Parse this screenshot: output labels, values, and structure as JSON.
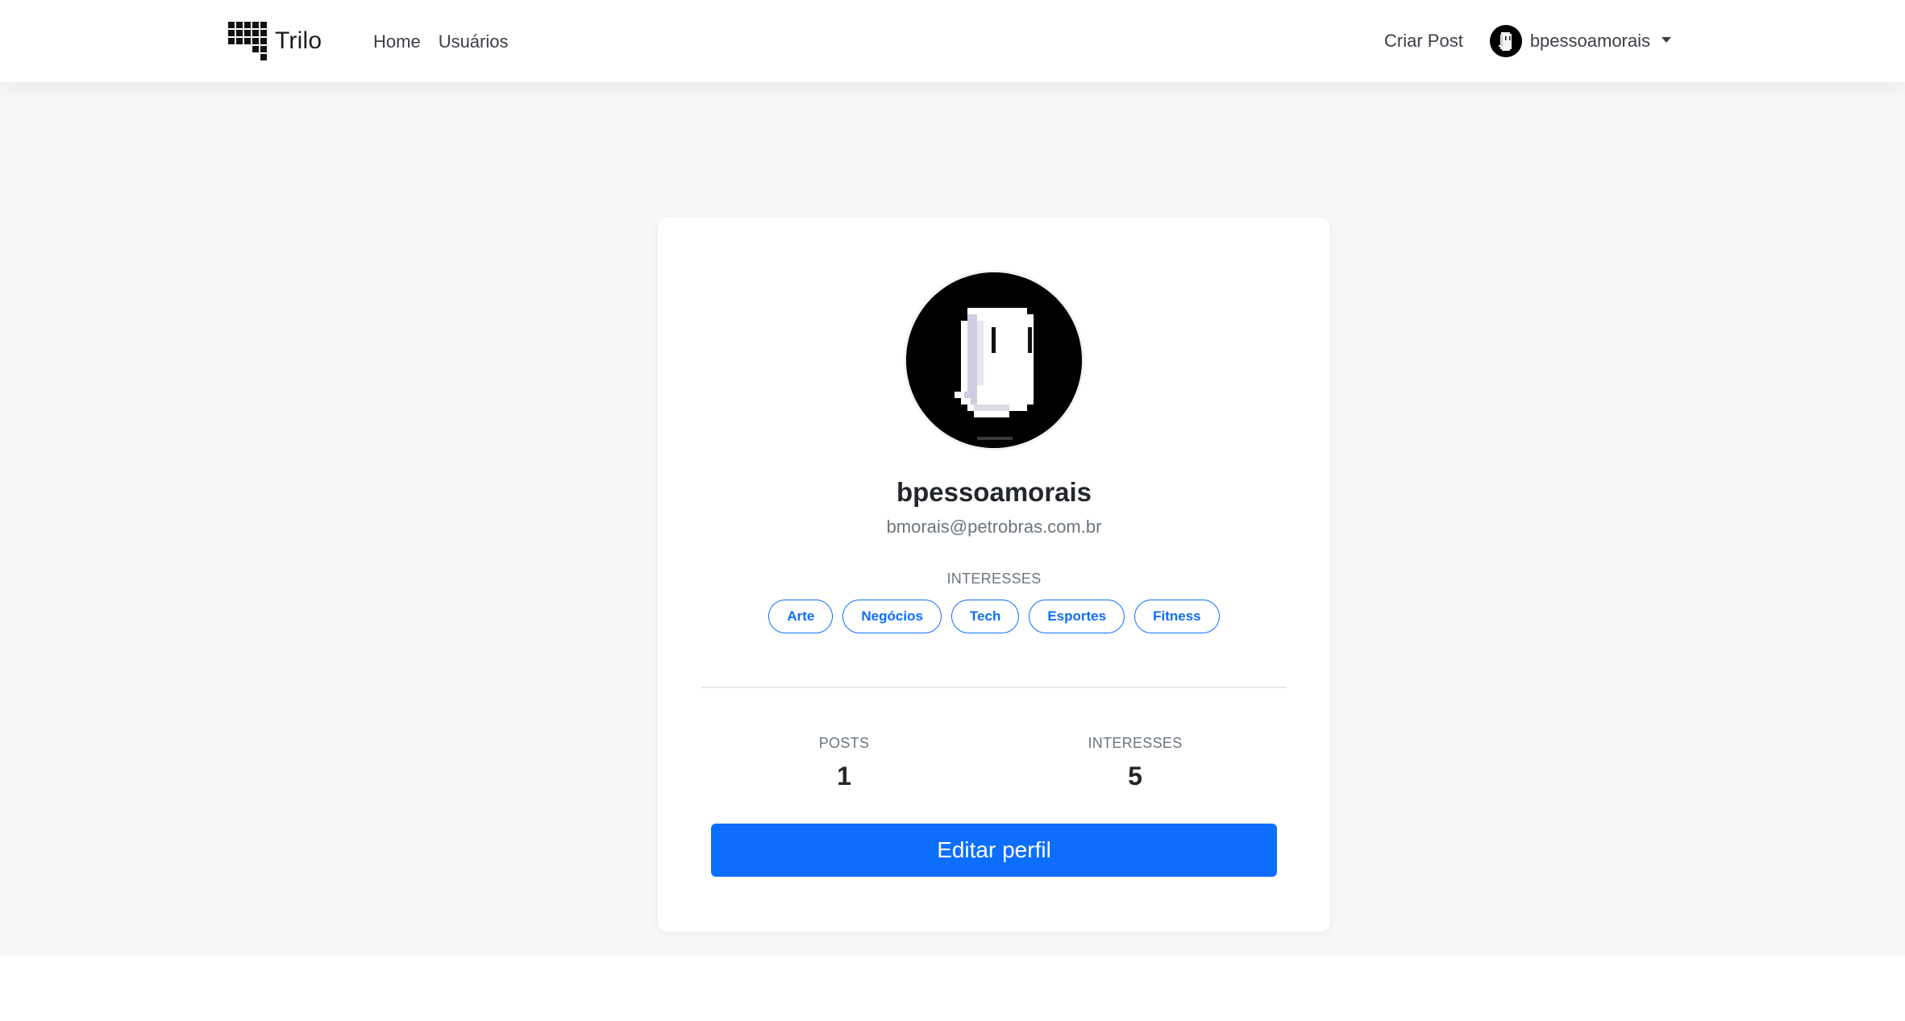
{
  "nav": {
    "brand": "Trilo",
    "links": [
      "Home",
      "Usuários"
    ],
    "create_post": "Criar Post",
    "username": "bpessoamorais"
  },
  "profile": {
    "username": "bpessoamorais",
    "email": "bmorais@petrobras.com.br",
    "interests_title": "INTERESSES",
    "interests": [
      "Arte",
      "Negócios",
      "Tech",
      "Esportes",
      "Fitness"
    ],
    "stats": {
      "posts_label": "POSTS",
      "posts_value": "1",
      "interests_label": "INTERESSES",
      "interests_value": "5"
    },
    "edit_button": "Editar perfil"
  },
  "colors": {
    "primary": "#0d6efd",
    "page_background": "#f7f8fa",
    "card_background": "#ffffff"
  },
  "icons": {
    "brand": "grid-logo-icon",
    "avatar": "ghost-avatar-icon",
    "dropdown": "caret-down-icon"
  }
}
